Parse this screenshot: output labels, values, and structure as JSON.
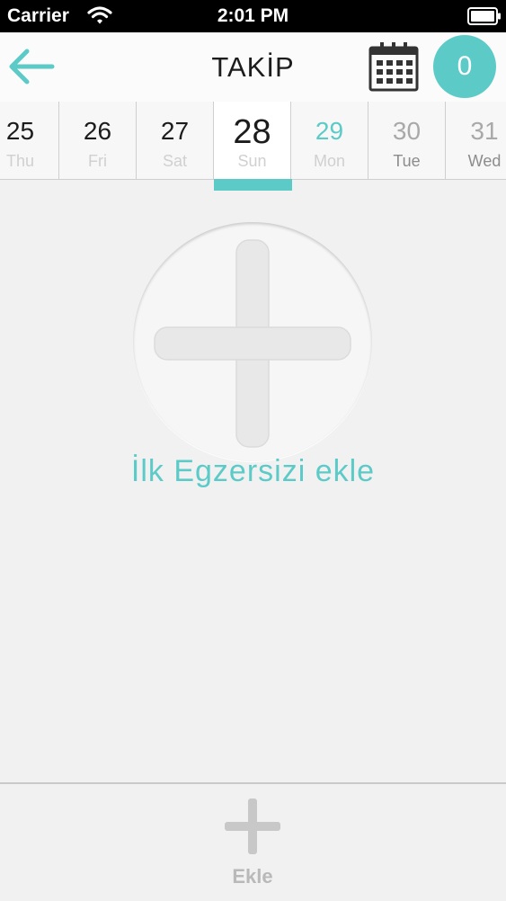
{
  "status_bar": {
    "carrier": "Carrier",
    "time": "2:01 PM"
  },
  "nav": {
    "title": "TAKİP",
    "badge_count": "0"
  },
  "days": [
    {
      "num": "25",
      "name": "Thu",
      "state": "past"
    },
    {
      "num": "26",
      "name": "Fri",
      "state": "past"
    },
    {
      "num": "27",
      "name": "Sat",
      "state": "past"
    },
    {
      "num": "28",
      "name": "Sun",
      "state": "selected"
    },
    {
      "num": "29",
      "name": "Mon",
      "state": "today"
    },
    {
      "num": "30",
      "name": "Tue",
      "state": "future"
    },
    {
      "num": "31",
      "name": "Wed",
      "state": "future"
    }
  ],
  "main": {
    "add_first_label": "İlk Egzersizi ekle"
  },
  "bottom": {
    "add_label": "Ekle"
  },
  "colors": {
    "accent": "#5ccbc8",
    "background": "#f2f1f2"
  },
  "icons": [
    "wifi-icon",
    "battery-icon",
    "back-arrow-icon",
    "calendar-icon",
    "plus-icon"
  ]
}
